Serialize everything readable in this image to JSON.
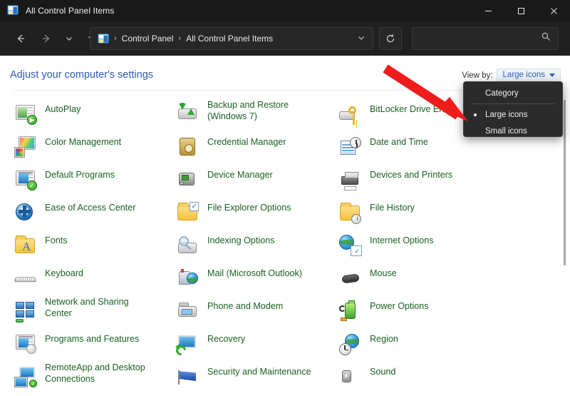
{
  "window": {
    "title": "All Control Panel Items",
    "title_icon": "control-panel-icon",
    "minimize_label": "—",
    "maximize_label": "□",
    "close_label": "✕"
  },
  "navbar": {
    "back_label": "←",
    "forward_label": "→",
    "recent_label": "⌄",
    "up_label": "↑",
    "refresh_label": "⟳",
    "address_chevron": "⌄",
    "breadcrumbs": [
      "Control Panel",
      "All Control Panel Items"
    ],
    "separator": "›",
    "search_placeholder": "",
    "search_value": "",
    "search_icon": "search-icon"
  },
  "content": {
    "heading": "Adjust your computer's settings",
    "heading_color": "#2b5bb5",
    "item_text_color": "#1a6121",
    "view_by_label": "View by:",
    "view_by_value": "Large icons"
  },
  "menu": {
    "items": [
      {
        "label": "Category",
        "selected": false
      },
      {
        "label": "Large icons",
        "selected": true
      },
      {
        "label": "Small icons",
        "selected": false
      }
    ]
  },
  "annotation": {
    "type": "red-arrow",
    "color": "#ef1c1c",
    "points_to": "Large icons"
  },
  "items": [
    {
      "label": "AutoPlay",
      "icon": "autoplay-icon",
      "col": 0,
      "row": 0,
      "lines": 1
    },
    {
      "label": "Color Management",
      "icon": "color-management-icon",
      "col": 0,
      "row": 1,
      "lines": 1
    },
    {
      "label": "Default Programs",
      "icon": "default-programs-icon",
      "col": 0,
      "row": 2,
      "lines": 1
    },
    {
      "label": "Ease of Access Center",
      "icon": "ease-of-access-icon",
      "col": 0,
      "row": 3,
      "lines": 1
    },
    {
      "label": "Fonts",
      "icon": "fonts-icon",
      "col": 0,
      "row": 4,
      "lines": 1
    },
    {
      "label": "Keyboard",
      "icon": "keyboard-icon",
      "col": 0,
      "row": 5,
      "lines": 1
    },
    {
      "label": "Network and Sharing Center",
      "icon": "network-sharing-icon",
      "col": 0,
      "row": 6,
      "lines": 2
    },
    {
      "label": "Programs and Features",
      "icon": "programs-features-icon",
      "col": 0,
      "row": 7,
      "lines": 1
    },
    {
      "label": "RemoteApp and Desktop Connections",
      "icon": "remoteapp-icon",
      "col": 0,
      "row": 8,
      "lines": 2
    },
    {
      "label": "Backup and Restore (Windows 7)",
      "icon": "backup-restore-icon",
      "col": 1,
      "row": 0,
      "lines": 2
    },
    {
      "label": "Credential Manager",
      "icon": "credential-manager-icon",
      "col": 1,
      "row": 1,
      "lines": 1
    },
    {
      "label": "Device Manager",
      "icon": "device-manager-icon",
      "col": 1,
      "row": 2,
      "lines": 1
    },
    {
      "label": "File Explorer Options",
      "icon": "file-explorer-options-icon",
      "col": 1,
      "row": 3,
      "lines": 1
    },
    {
      "label": "Indexing Options",
      "icon": "indexing-options-icon",
      "col": 1,
      "row": 4,
      "lines": 1
    },
    {
      "label": "Mail (Microsoft Outlook)",
      "icon": "mail-icon",
      "col": 1,
      "row": 5,
      "lines": 1
    },
    {
      "label": "Phone and Modem",
      "icon": "phone-modem-icon",
      "col": 1,
      "row": 6,
      "lines": 1
    },
    {
      "label": "Recovery",
      "icon": "recovery-icon",
      "col": 1,
      "row": 7,
      "lines": 1
    },
    {
      "label": "Security and Maintenance",
      "icon": "security-maintenance-icon",
      "col": 1,
      "row": 8,
      "lines": 1
    },
    {
      "label": "BitLocker Drive Encry",
      "icon": "bitlocker-icon",
      "col": 2,
      "row": 0,
      "lines": 1
    },
    {
      "label": "Date and Time",
      "icon": "date-time-icon",
      "col": 2,
      "row": 1,
      "lines": 1
    },
    {
      "label": "Devices and Printers",
      "icon": "devices-printers-icon",
      "col": 2,
      "row": 2,
      "lines": 1
    },
    {
      "label": "File History",
      "icon": "file-history-icon",
      "col": 2,
      "row": 3,
      "lines": 1
    },
    {
      "label": "Internet Options",
      "icon": "internet-options-icon",
      "col": 2,
      "row": 4,
      "lines": 1
    },
    {
      "label": "Mouse",
      "icon": "mouse-icon",
      "col": 2,
      "row": 5,
      "lines": 1
    },
    {
      "label": "Power Options",
      "icon": "power-options-icon",
      "col": 2,
      "row": 6,
      "lines": 1
    },
    {
      "label": "Region",
      "icon": "region-icon",
      "col": 2,
      "row": 7,
      "lines": 1
    },
    {
      "label": "Sound",
      "icon": "sound-icon",
      "col": 2,
      "row": 8,
      "lines": 1
    }
  ]
}
